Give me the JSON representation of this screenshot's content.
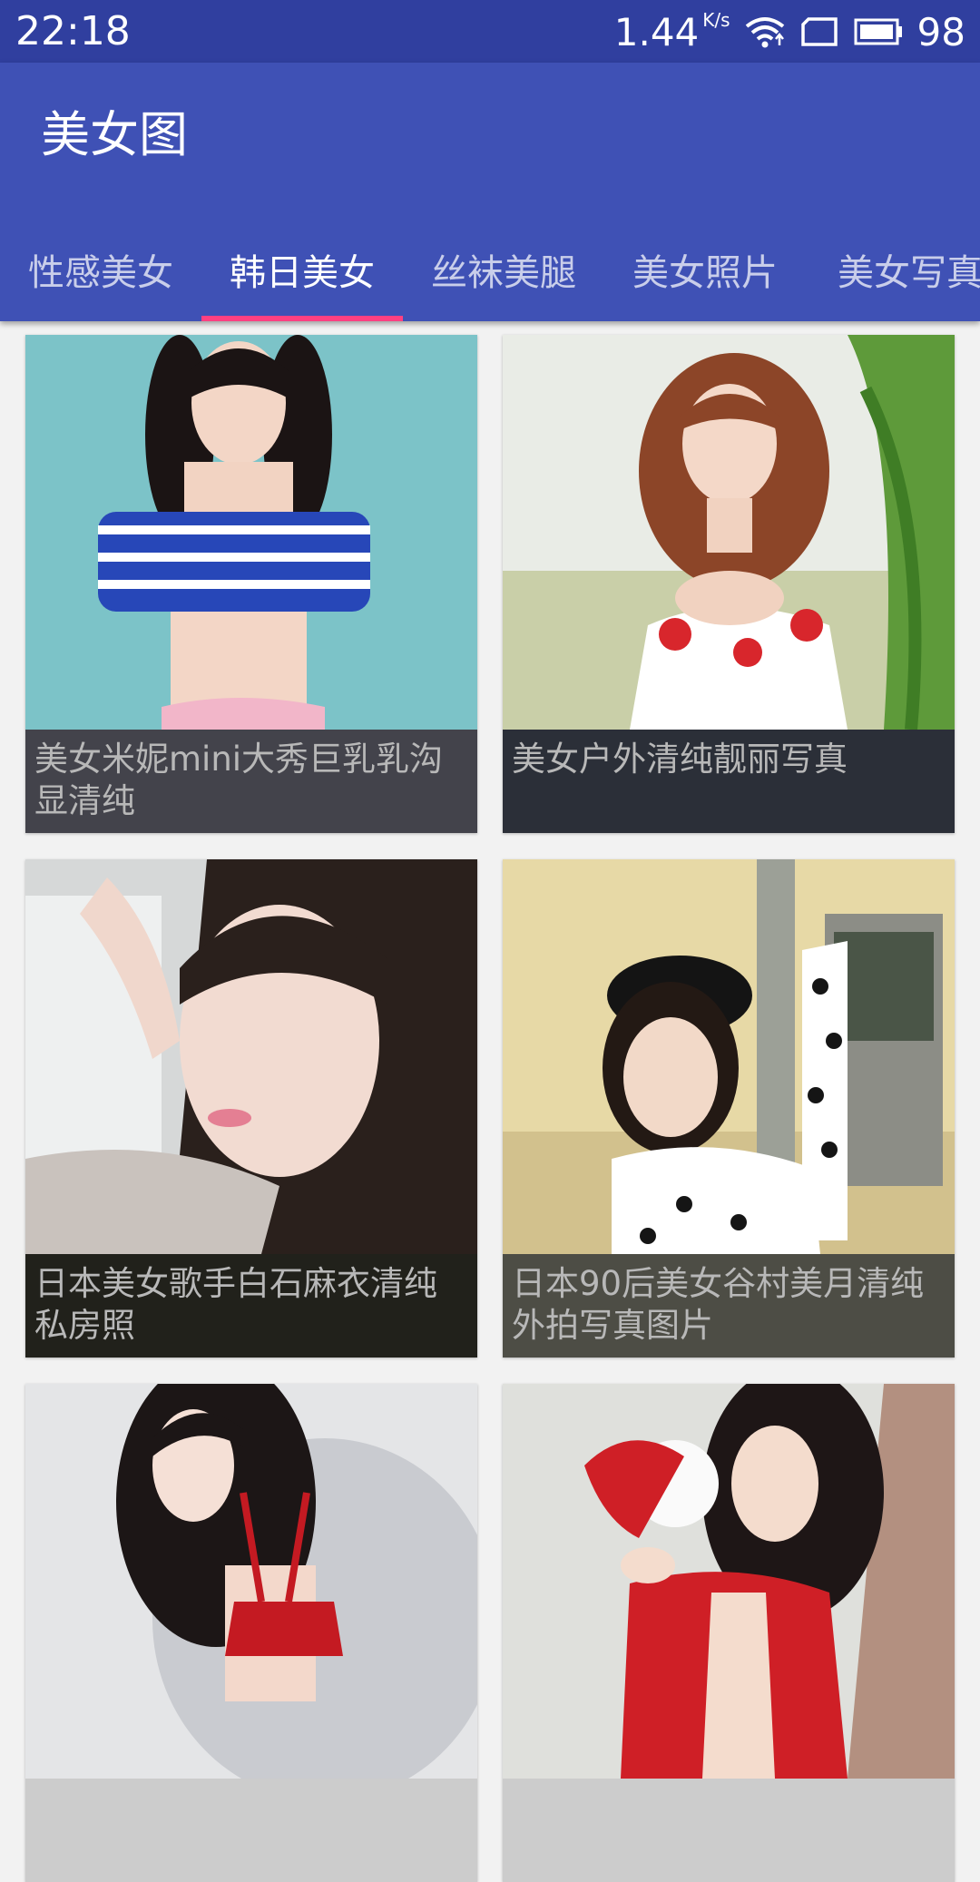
{
  "status_bar": {
    "time": "22:18",
    "net_speed": "1.44",
    "net_unit": "K/s",
    "battery": "98",
    "icons": [
      "wifi-icon",
      "sim-icon",
      "battery-icon"
    ]
  },
  "app_bar": {
    "title": "美女图",
    "color": "#3f51b5",
    "status_color": "#303f9f"
  },
  "tabs": [
    {
      "label": "性感美女",
      "selected": false
    },
    {
      "label": "韩日美女",
      "selected": true
    },
    {
      "label": "丝袜美腿",
      "selected": false
    },
    {
      "label": "美女照片",
      "selected": false
    },
    {
      "label": "美女写真",
      "selected": false
    }
  ],
  "accent_color": "#ff4081",
  "cards": [
    {
      "caption": "美女米妮mini大秀巨乳乳沟显清纯",
      "caption_bg": "#43434b"
    },
    {
      "caption": "美女户外清纯靓丽写真",
      "caption_bg": "#2b2f38"
    },
    {
      "caption": "日本美女歌手白石麻衣清纯私房照",
      "caption_bg": "#21211b"
    },
    {
      "caption": "日本90后美女谷村美月清纯外拍写真图片",
      "caption_bg": "#4d4d45"
    },
    {
      "caption": "",
      "caption_bg": ""
    },
    {
      "caption": "",
      "caption_bg": ""
    }
  ]
}
